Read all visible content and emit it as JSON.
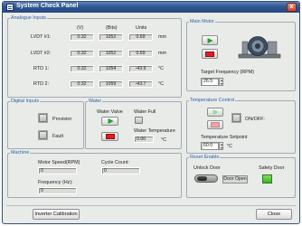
{
  "window": {
    "title": "System Check Panel",
    "close_glyph": "x"
  },
  "analogue": {
    "legend": "Analogue Inputs",
    "col_v": "(V)",
    "col_bits": "(Bits)",
    "col_units": "Units",
    "rows": [
      {
        "label": "LVDT #1:",
        "v": "0.32",
        "bits": "1052",
        "value": "0.69",
        "unit": "mm"
      },
      {
        "label": "LVDT #2:",
        "v": "0.32",
        "bits": "1052",
        "value": "0.69",
        "unit": "mm"
      },
      {
        "label": "RTD 1:",
        "v": "0.32",
        "bits": "1054",
        "value": "-43.9",
        "unit": "°C"
      },
      {
        "label": "RTD 2:",
        "v": "0.32",
        "bits": "1059",
        "value": "-43.7",
        "unit": "°C"
      }
    ]
  },
  "main_motor": {
    "legend": "Main Motor",
    "target_label": "Target Frequency (RPM)",
    "target_value": "26.5",
    "icon": "motor-icon"
  },
  "digital": {
    "legend": "Digital Inputs",
    "proximity_label": "Provistor",
    "fault_label": "Fault"
  },
  "water": {
    "legend": "Water",
    "valve_label": "Water Valve",
    "full_label": "Water Full",
    "temp_label": "Water Temperature",
    "temp_value": "0.00",
    "temp_unit": "°C"
  },
  "temperature": {
    "legend": "Temperature Control",
    "onoff_label": "ON/OFF:",
    "setpoint_label": "Temperature Setpoint",
    "setpoint_value": "60.0",
    "setpoint_unit": "°C"
  },
  "machine": {
    "legend": "Machine",
    "speed_label": "Motor Speed(RPM)",
    "speed_value": "0",
    "cycle_label": "Cycle Count:",
    "cycle_value": "0",
    "freq_label": "Frequency (Hz):",
    "freq_value": "0"
  },
  "reset": {
    "legend": "Reset Enable",
    "unlock_label": "Unlock Door",
    "door_status": "Door Open",
    "safety_label": "Safety Door"
  },
  "footer": {
    "inverter_button": "Inverter Calibration",
    "close_button": "Close"
  },
  "colors": {
    "titlebar": "#2f5791",
    "legend_text": "#2d5fa6",
    "go_green": "#18a223",
    "stop_red": "#e31e1e",
    "led_on": "#2fbf3a"
  }
}
